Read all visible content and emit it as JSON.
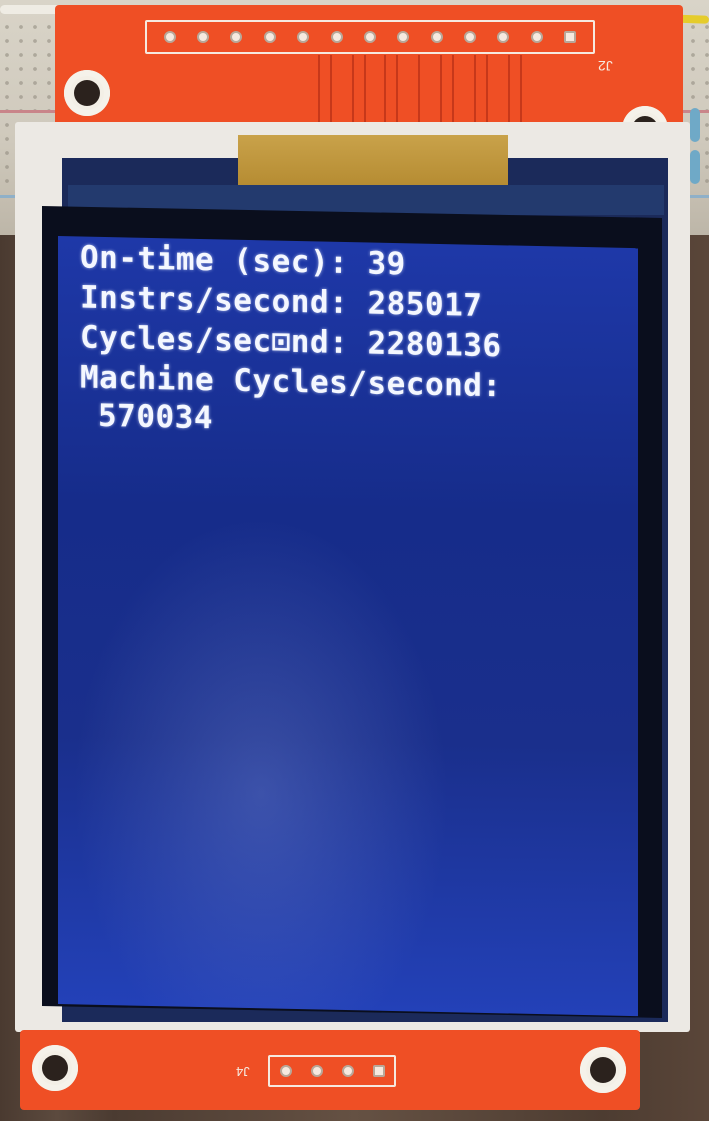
{
  "pcb": {
    "header_top_label": "J2",
    "header_bottom_label": "J4",
    "top_pin_count": 13,
    "bottom_pin_count": 4,
    "board_color": "#ef4f25"
  },
  "display": {
    "background_color": "#1a2f8c",
    "text_color": "#f4f7ff",
    "lines": [
      "On-time (sec): 39",
      "Instrs/second: 285017",
      "Cycles/sec⊡nd: 2280136",
      "Machine Cycles/second:",
      "570034"
    ]
  }
}
